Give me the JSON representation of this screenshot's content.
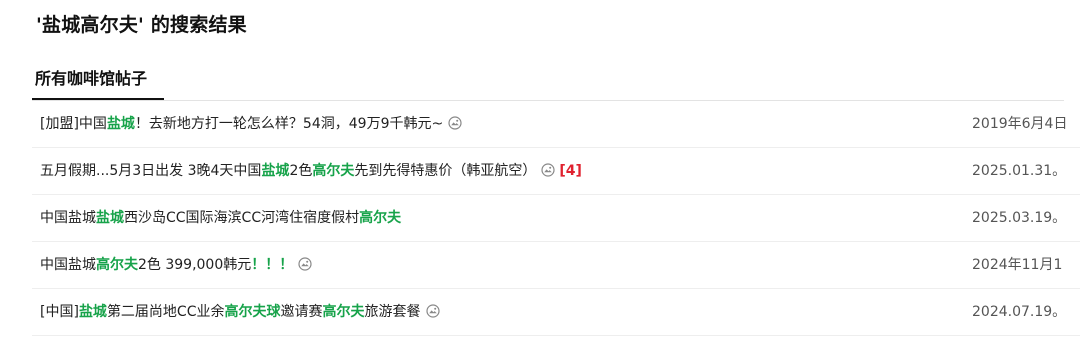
{
  "page": {
    "title": "'盐城高尔夫' 的搜索结果"
  },
  "tabs": [
    {
      "label": "所有咖啡馆帖子",
      "active": true
    }
  ],
  "colors": {
    "highlight": "#17a34a",
    "reply_count": "#e0222f"
  },
  "posts": [
    {
      "segments": [
        {
          "t": "[加盟]中国",
          "hl": false
        },
        {
          "t": "盐城",
          "hl": true
        },
        {
          "t": "！去新地方打一轮怎么样？54洞，49万9千韩元~",
          "hl": false
        }
      ],
      "has_photo_icon": true,
      "photo_icon": "camera-icon",
      "reply_count": "",
      "date": "2019年6月4日"
    },
    {
      "segments": [
        {
          "t": "五月假期...5月3日出发 3晚4天中国",
          "hl": false
        },
        {
          "t": "盐城",
          "hl": true
        },
        {
          "t": "2色",
          "hl": false
        },
        {
          "t": "高尔夫",
          "hl": true
        },
        {
          "t": "先到先得特惠价（韩亚航空）",
          "hl": false
        }
      ],
      "has_photo_icon": true,
      "photo_icon": "camera-icon",
      "reply_count": "[4]",
      "date": "2025.01.31。"
    },
    {
      "segments": [
        {
          "t": "中国盐城",
          "hl": false
        },
        {
          "t": "盐城",
          "hl": true
        },
        {
          "t": "西沙岛CC国际海滨CC河湾住宿度假村",
          "hl": false
        },
        {
          "t": "高尔夫",
          "hl": true
        }
      ],
      "has_photo_icon": false,
      "photo_icon": "",
      "reply_count": "",
      "date": "2025.03.19。"
    },
    {
      "segments": [
        {
          "t": "中国盐城",
          "hl": false
        },
        {
          "t": "高尔夫",
          "hl": true
        },
        {
          "t": "2色 399,000韩元",
          "hl": false
        },
        {
          "t": "！！！",
          "hl": true
        }
      ],
      "has_photo_icon": true,
      "photo_icon": "camera-icon",
      "reply_count": "",
      "date": "2024年11月1"
    },
    {
      "segments": [
        {
          "t": "[中国]",
          "hl": false
        },
        {
          "t": "盐城",
          "hl": true
        },
        {
          "t": "第二届尚地CC业余",
          "hl": false
        },
        {
          "t": "高尔夫球",
          "hl": true
        },
        {
          "t": "邀请赛",
          "hl": false
        },
        {
          "t": "高尔夫",
          "hl": true
        },
        {
          "t": "旅游套餐",
          "hl": false
        }
      ],
      "has_photo_icon": true,
      "photo_icon": "camera-icon",
      "reply_count": "",
      "date": "2024.07.19。"
    }
  ]
}
